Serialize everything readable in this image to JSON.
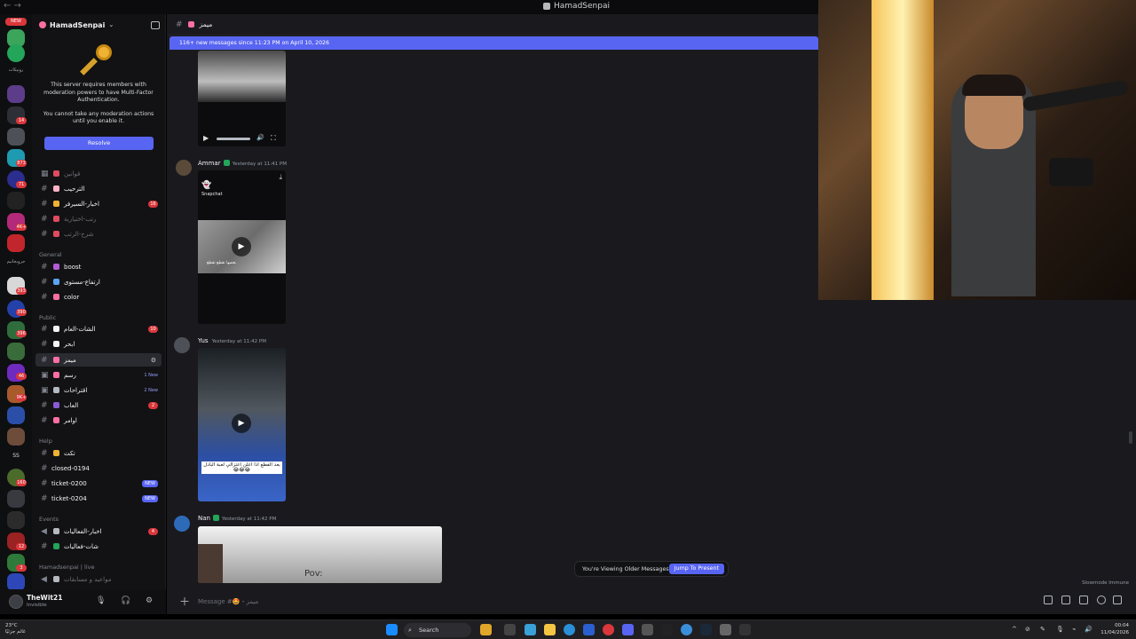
{
  "window": {
    "title": "HamadSenpai"
  },
  "guild": {
    "name": "HamadSenpai",
    "mfa_text": "This server requires members with moderation powers to have Multi-Factor Authentication.",
    "mfa_text2": "You cannot take any moderation actions until you enable it.",
    "resolve_label": "Resolve"
  },
  "rail": {
    "new_badge": "NEW",
    "labels": [
      "روبيكات",
      "جروبجانيم"
    ],
    "badges": [
      "14",
      "873",
      "71",
      "4K+",
      "393",
      "390",
      "396",
      "8K+",
      "46",
      "9K+",
      "SS",
      "160",
      "12",
      "3"
    ]
  },
  "channels": {
    "top": [
      {
        "name": "قوانين",
        "muted": true,
        "icon_color": "#e04b5f"
      },
      {
        "name": "الترحيب",
        "muted": false,
        "icon_color": "#ffb3c8"
      },
      {
        "name": "اخبار-السيرفر",
        "muted": false,
        "icon_color": "#f0b232",
        "count": "16"
      },
      {
        "name": "رتب-اختيارية",
        "muted": true,
        "icon_color": "#e04b5f"
      },
      {
        "name": "شرح-الرتب",
        "muted": true,
        "icon_color": "#e04b5f"
      }
    ],
    "categories": [
      "General",
      "Public",
      "Help",
      "Events",
      "Hamadsenpai | live"
    ],
    "general": [
      {
        "name": "boost",
        "icon_color": "#b35ad6"
      },
      {
        "name": "ارتفاع-مستوى",
        "icon_color": "#5ba4f5"
      },
      {
        "name": "color",
        "icon_color": "#ff6fa5"
      }
    ],
    "public": [
      {
        "name": "الشات-العام",
        "icon_color": "#f2f3f5",
        "count": "10"
      },
      {
        "name": "ابحر",
        "icon_color": "#f2f3f5"
      },
      {
        "name": "ميمز",
        "icon_color": "#ff6fa5",
        "active": true
      },
      {
        "name": "رسم",
        "icon_color": "#ff6fa5",
        "new_text": "1 New"
      },
      {
        "name": "اقتراحات",
        "icon_color": "#b5bac1",
        "new_text": "2 New"
      },
      {
        "name": "العاب",
        "icon_color": "#8a5ad6",
        "count": "2"
      },
      {
        "name": "اوامر",
        "icon_color": "#ff6fa5"
      }
    ],
    "help": [
      {
        "name": "تكت",
        "icon_color": "#f0b232"
      },
      {
        "name": "closed-0194"
      },
      {
        "name": "ticket-0200",
        "pill": "NEW"
      },
      {
        "name": "ticket-0204",
        "pill": "NEW"
      }
    ],
    "events": [
      {
        "name": "اخبار-الفعاليات",
        "icon_color": "#b5bac1",
        "count": "4"
      },
      {
        "name": "شات-فعاليات",
        "icon_color": "#23a55a"
      }
    ],
    "live": [
      {
        "name": "مواعيد و مسابقات",
        "icon_color": "#b5bac1"
      }
    ]
  },
  "user": {
    "name": "TheWit21",
    "status": "Invisible"
  },
  "chat": {
    "channel_name": "ميمز",
    "new_messages_bar": "116+ new messages since 11:23 PM on April 10, 2026",
    "messages": [
      {
        "author": "Ammar",
        "timestamp": "Yesterday at 11:41 PM",
        "media_label": "Snapchat",
        "caption": "بعضها تقطع تقطع"
      },
      {
        "author": "Yus",
        "timestamp": "Yesterday at 11:42 PM",
        "caption": "بعد الفطع اذا اعلن اعتزالي لعبة البادل 😂😂😂"
      },
      {
        "author": "Nan",
        "timestamp": "Yesterday at 11:42 PM",
        "caption": "Pov:"
      }
    ],
    "older_text": "You're Viewing Older Messages",
    "jump_label": "Jump To Present",
    "composer_placeholder": "Message #🤩・ميمز",
    "slowmode": "Slowmode Immune"
  },
  "taskbar": {
    "weather_temp": "23°C",
    "weather_desc": "غائم جزئيًا",
    "search_label": "Search",
    "time": "00:04",
    "date": "11/04/2026"
  }
}
